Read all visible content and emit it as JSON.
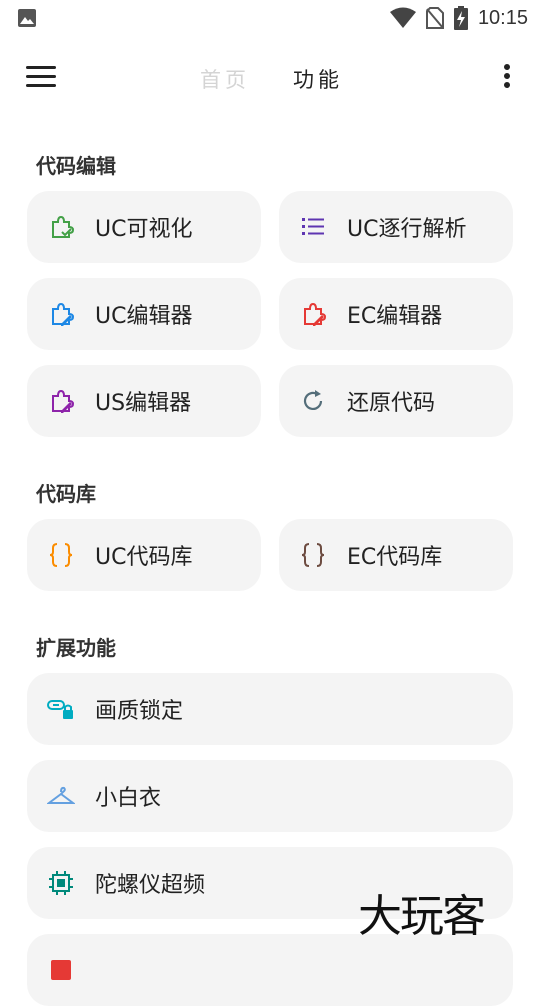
{
  "status_bar": {
    "time": "10:15"
  },
  "app_bar": {
    "tabs": [
      {
        "label": "首页"
      },
      {
        "label": "功能"
      }
    ],
    "icons": {
      "menu": "menu-icon",
      "more": "more-vert-icon"
    }
  },
  "sections": {
    "code_edit": {
      "title": "代码编辑",
      "items": [
        {
          "label": "UC可视化",
          "icon": "puzzle-check-icon",
          "color": "#43a047"
        },
        {
          "label": "UC逐行解析",
          "icon": "list-icon",
          "color": "#5e35b1"
        },
        {
          "label": "UC编辑器",
          "icon": "puzzle-edit-icon",
          "color": "#1e88e5"
        },
        {
          "label": "EC编辑器",
          "icon": "puzzle-edit-icon",
          "color": "#e53935"
        },
        {
          "label": "US编辑器",
          "icon": "puzzle-edit-icon",
          "color": "#8e24aa"
        },
        {
          "label": "还原代码",
          "icon": "refresh-icon",
          "color": "#546e7a"
        }
      ]
    },
    "code_lib": {
      "title": "代码库",
      "items": [
        {
          "label": "UC代码库",
          "icon": "braces-icon",
          "color": "#fb8c00"
        },
        {
          "label": "EC代码库",
          "icon": "braces-icon",
          "color": "#6d4c41"
        }
      ]
    },
    "extensions": {
      "title": "扩展功能",
      "items": [
        {
          "label": "画质锁定",
          "icon": "link-lock-icon",
          "color": "#00acc1"
        },
        {
          "label": "小白衣",
          "icon": "hanger-icon",
          "color": "#64a0e0"
        },
        {
          "label": "陀螺仪超频",
          "icon": "chip-icon",
          "color": "#00897b"
        },
        {
          "label": "",
          "icon": "partial-icon",
          "color": "#e53935"
        }
      ]
    }
  },
  "watermark": "大玩客"
}
